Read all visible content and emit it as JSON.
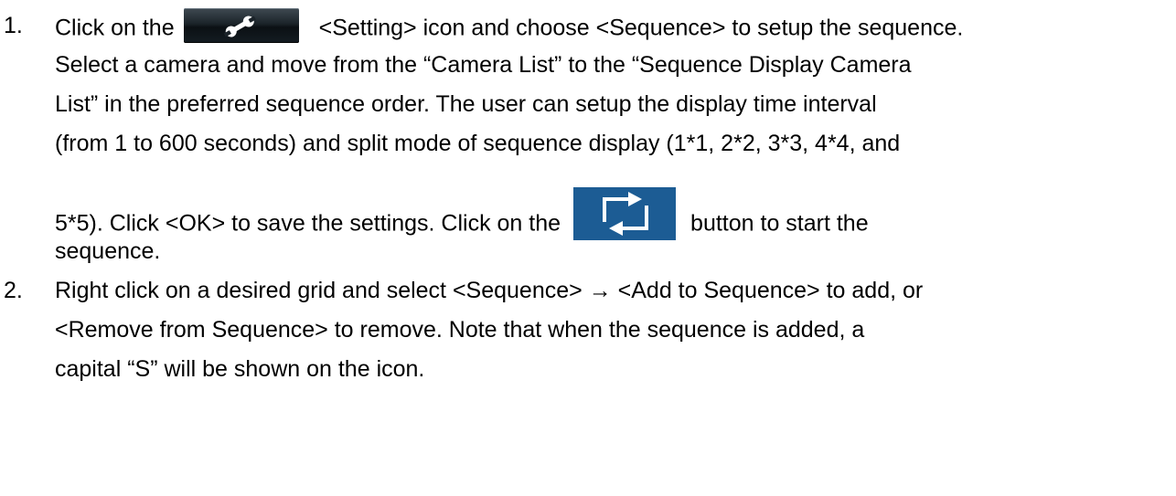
{
  "items": [
    {
      "number": "1.",
      "lines": {
        "l1_before": "Click on the",
        "l1_after": "<Setting> icon and choose <Sequence> to setup the sequence.",
        "l2": "Select a camera and move from the “Camera List” to the “Sequence Display Camera",
        "l3": "List” in the preferred sequence order. The user can setup the display time interval",
        "l4": "(from 1 to 600 seconds) and split mode of sequence display (1*1, 2*2, 3*3, 4*4, and",
        "l5_before": "5*5). Click <OK> to save the settings. Click on the",
        "l5_after": "button to start the",
        "l6": "sequence."
      },
      "icons": [
        "wrench-icon",
        "sequence-arrows-icon"
      ]
    },
    {
      "number": "2.",
      "lines": {
        "l1": "Right click on a desired grid and select <Sequence> → <Add to Sequence> to add, or",
        "l2": "<Remove from Sequence> to remove. Note that when the sequence is added, a",
        "l3": "capital “S” will be shown on the icon."
      }
    }
  ],
  "colors": {
    "text": "#000000",
    "setting_button": "#1b2329",
    "sequence_button": "#1c5c94"
  }
}
